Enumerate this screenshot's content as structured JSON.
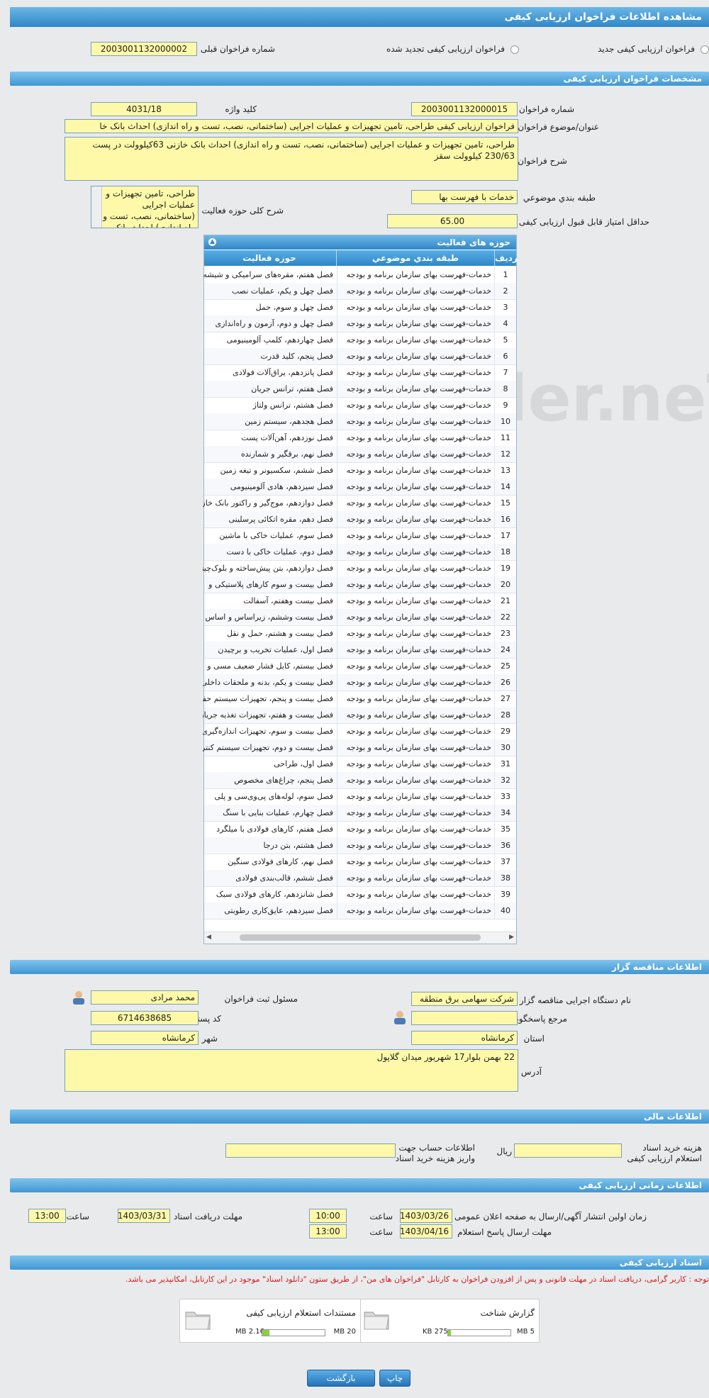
{
  "title": "مشاهده اطلاعات فراخوان ارزیابی کیفی",
  "type_options": {
    "new_label": "فراخوان ارزیابی کیفی جدید",
    "renewed_label": "فراخوان ارزیابی کیفی تجدید شده",
    "prev_label": "شماره فراخوان قبلی",
    "prev_value": "2003001132000002"
  },
  "spec": {
    "header": "مشخصات فراخوان ارزیابی کیفی",
    "number_label": "شماره فراخوان",
    "number_value": "2003001132000015",
    "keyword_label": "کلید واژه",
    "keyword_value": "4031/18",
    "subject_label": "عنوان/موضوع فراخوان",
    "subject_value": "فراخوان ارزیابی کیفی طراحی، تامین تجهیزات و عملیات اجرایی (ساختمانی، نصب، تست و راه اندازی) احداث بانک خا",
    "desc_label": "شرح فراخوان",
    "desc_value": "طراحی، تامین تجهیزات و عملیات اجرایی (ساختمانی، نصب، تست و راه اندازی) احداث بانک خازنی 63کیلوولت در پست 230/63 کیلوولت سقز",
    "category_label": "طبقه بندي موضوعي",
    "category_value": "خدمات با فهرست بها",
    "scope_label": "شرح کلی حوزه فعالیت",
    "scope_value": "طراحی، تامین تجهیزات و عملیات اجرایی (ساختمانی، نصب، تست و راه اندازی) احداث بانک",
    "min_score_label": "حداقل امتیاز قابل قبول ارزیابی کیفی",
    "min_score_value": "65.00"
  },
  "activities": {
    "title": "حوزه های فعالیت",
    "col_row": "رديف",
    "col_cat": "طبقه بندي موضوعي",
    "col_act": "حوزه فعالیت",
    "rows": [
      {
        "n": "1",
        "cat": "خدمات-فهرست بهای سازمان برنامه و بودجه",
        "act": "فصل هفتم، مقره‌های سرامیکی و شیشه"
      },
      {
        "n": "2",
        "cat": "خدمات-فهرست بهای سازمان برنامه و بودجه",
        "act": "فصل چهل و یکم، عملیات نصب"
      },
      {
        "n": "3",
        "cat": "خدمات-فهرست بهای سازمان برنامه و بودجه",
        "act": "فصل چهل و سوم، حمل"
      },
      {
        "n": "4",
        "cat": "خدمات-فهرست بهای سازمان برنامه و بودجه",
        "act": "فصل چهل و دوم، آزمون و راه‌اندازی"
      },
      {
        "n": "5",
        "cat": "خدمات-فهرست بهای سازمان برنامه و بودجه",
        "act": "فصل چهاردهم، کلمپ آلومینیومی"
      },
      {
        "n": "6",
        "cat": "خدمات-فهرست بهای سازمان برنامه و بودجه",
        "act": "فصل پنجم، کلید قدرت"
      },
      {
        "n": "7",
        "cat": "خدمات-فهرست بهای سازمان برنامه و بودجه",
        "act": "فصل پانزدهم، یراق‌آلات فولادی"
      },
      {
        "n": "8",
        "cat": "خدمات-فهرست بهای سازمان برنامه و بودجه",
        "act": "فصل هفتم، ترانس جریان"
      },
      {
        "n": "9",
        "cat": "خدمات-فهرست بهای سازمان برنامه و بودجه",
        "act": "فصل هشتم، ترانس ولتاژ"
      },
      {
        "n": "10",
        "cat": "خدمات-فهرست بهای سازمان برنامه و بودجه",
        "act": "فصل هجدهم، سیستم زمین"
      },
      {
        "n": "11",
        "cat": "خدمات-فهرست بهای سازمان برنامه و بودجه",
        "act": "فصل نوزدهم، آهن‌آلات پست"
      },
      {
        "n": "12",
        "cat": "خدمات-فهرست بهای سازمان برنامه و بودجه",
        "act": "فصل نهم، برقگیر و شمارنده"
      },
      {
        "n": "13",
        "cat": "خدمات-فهرست بهای سازمان برنامه و بودجه",
        "act": "فصل ششم، سکسیونر و تیغه زمین"
      },
      {
        "n": "14",
        "cat": "خدمات-فهرست بهای سازمان برنامه و بودجه",
        "act": "فصل سیزدهم، هادی آلومینیومی"
      },
      {
        "n": "15",
        "cat": "خدمات-فهرست بهای سازمان برنامه و بودجه",
        "act": "فصل دوازدهم، موج‌گیر و راکتور بانک خازنی"
      },
      {
        "n": "16",
        "cat": "خدمات-فهرست بهای سازمان برنامه و بودجه",
        "act": "فصل دهم، مقره اتکائی پرسلینی"
      },
      {
        "n": "17",
        "cat": "خدمات-فهرست بهای سازمان برنامه و بودجه",
        "act": "فصل سوم، عملیات خاکی با ماشین"
      },
      {
        "n": "18",
        "cat": "خدمات-فهرست بهای سازمان برنامه و بودجه",
        "act": "فصل دوم، عملیات خاکی با دست"
      },
      {
        "n": "19",
        "cat": "خدمات-فهرست بهای سازمان برنامه و بودجه",
        "act": "فصل دوازدهم، بتن پیش‌ساخته و بلوک‌چینی"
      },
      {
        "n": "20",
        "cat": "خدمات-فهرست بهای سازمان برنامه و بودجه",
        "act": "فصل بیست و سوم کارهای پلاستیکی و"
      },
      {
        "n": "21",
        "cat": "خدمات-فهرست بهای سازمان برنامه و بودجه",
        "act": "فصل بیست وهفتم، آسفالت"
      },
      {
        "n": "22",
        "cat": "خدمات-فهرست بهای سازمان برنامه و بودجه",
        "act": "فصل بیست وششم، زیراساس و اساس"
      },
      {
        "n": "23",
        "cat": "خدمات-فهرست بهای سازمان برنامه و بودجه",
        "act": "فصل بیست و هشتم، حمل و نقل"
      },
      {
        "n": "24",
        "cat": "خدمات-فهرست بهای سازمان برنامه و بودجه",
        "act": "فصل اول، عملیات تخریب و برچیدن"
      },
      {
        "n": "25",
        "cat": "خدمات-فهرست بهای سازمان برنامه و بودجه",
        "act": "فصل بیستم، کابل فشار ضعیف مسی و"
      },
      {
        "n": "26",
        "cat": "خدمات-فهرست بهای سازمان برنامه و بودجه",
        "act": "فصل بیست و یکم، بدنه و ملحقات داخلی"
      },
      {
        "n": "27",
        "cat": "خدمات-فهرست بهای سازمان برنامه و بودجه",
        "act": "فصل بیست و پنجم، تجهیزات سیستم حفاظت الکتریکی"
      },
      {
        "n": "28",
        "cat": "خدمات-فهرست بهای سازمان برنامه و بودجه",
        "act": "فصل بیست و هفتم، تجهیزات تغذیه جریان متناوب و مستقیم"
      },
      {
        "n": "29",
        "cat": "خدمات-فهرست بهای سازمان برنامه و بودجه",
        "act": "فصل بیست و سوم، تجهیزات اندازه‌گیری و ثبات"
      },
      {
        "n": "30",
        "cat": "خدمات-فهرست بهای سازمان برنامه و بودجه",
        "act": "فصل بیست و دوم، تجهیزات سیستم کنترل سنتی"
      },
      {
        "n": "31",
        "cat": "خدمات-فهرست بهای سازمان برنامه و بودجه",
        "act": "فصل اول، طراحی"
      },
      {
        "n": "32",
        "cat": "خدمات-فهرست بهای سازمان برنامه و بودجه",
        "act": "فصل پنجم، چراغ‌های مخصوص"
      },
      {
        "n": "33",
        "cat": "خدمات-فهرست بهای سازمان برنامه و بودجه",
        "act": "فصل سوم، لوله‌های پی‌وی‌سی و پلی"
      },
      {
        "n": "34",
        "cat": "خدمات-فهرست بهای سازمان برنامه و بودجه",
        "act": "فصل چهارم، عملیات بنایی با سنگ"
      },
      {
        "n": "35",
        "cat": "خدمات-فهرست بهای سازمان برنامه و بودجه",
        "act": "فصل هفتم، کارهای فولادی با میلگرد"
      },
      {
        "n": "36",
        "cat": "خدمات-فهرست بهای سازمان برنامه و بودجه",
        "act": "فصل هشتم، بتن درجا"
      },
      {
        "n": "37",
        "cat": "خدمات-فهرست بهای سازمان برنامه و بودجه",
        "act": "فصل نهم، کارهای فولادی سنگین"
      },
      {
        "n": "38",
        "cat": "خدمات-فهرست بهای سازمان برنامه و بودجه",
        "act": "فصل ششم، قالب‌بندی فولادی"
      },
      {
        "n": "39",
        "cat": "خدمات-فهرست بهای سازمان برنامه و بودجه",
        "act": "فصل شانزدهم، کارهای فولادی سبک"
      },
      {
        "n": "40",
        "cat": "خدمات-فهرست بهای سازمان برنامه و بودجه",
        "act": "فصل سیزدهم، عایق‌کاری رطوبتی"
      }
    ]
  },
  "tenderer": {
    "header": "اطلاعات مناقصه گزار",
    "org_label": "نام دستگاه اجرایی مناقصه گزار",
    "org_value": "شرکت سهامی برق منطقه",
    "registrar_label": "مسئول ثبت فراخوان",
    "registrar_value": "محمد مرادی",
    "ref_label": "مرجع پاسخگویی",
    "ref_value": "",
    "postal_label": "کد پستی",
    "postal_value": "6714638685",
    "province_label": "استان",
    "province_value": "کرمانشاه",
    "city_label": "شهر",
    "city_value": "کرمانشاه",
    "address_label": "آدرس",
    "address_value": "22 بهمن بلوار17 شهریور میدان گلاپول"
  },
  "finance": {
    "header": "اطلاعات مالی",
    "fee_label": "هزینه خرید اسناد استعلام ارزیابی کیفی",
    "currency": "ریال",
    "fee_value": "",
    "account_label": "اطلاعات حساب جهت واریز هزینه خرید اسناد",
    "account_value": ""
  },
  "timing": {
    "header": "اطلاعات زمانی ارزیابی کیفی",
    "publish_label": "زمان اولین انتشار آگهی/ارسال به صفحه اعلان عمومی",
    "publish_date": "1403/03/26",
    "publish_time": "10:00",
    "receive_label": "مهلت دریافت اسناد",
    "receive_date": "1403/03/31",
    "receive_time": "13:00",
    "reply_label": "مهلت ارسال پاسخ استعلام",
    "reply_date": "1403/04/16",
    "reply_time": "13:00",
    "time_label": "ساعت"
  },
  "documents": {
    "header": "اسناد ارزیابی کیفی",
    "note": "توجه : کاربر گرامی، دریافت اسناد در مهلت قانونی و پس از افزودن فراخوان به کارتابل \"فراخوان های من\"، از طریق ستون \"دانلود اسناد\" موجود در این کارتابل، امکانپذیر می باشد.",
    "files": [
      {
        "name": "گزارش شناخت",
        "size": "275 KB",
        "max": "5 MB",
        "fill": 0.05
      },
      {
        "name": "مستندات استعلام ارزیابی کیفی",
        "size": "2.16 MB",
        "max": "20 MB",
        "fill": 0.11
      }
    ]
  },
  "actions": {
    "print": "چاپ",
    "back": "بازگشت"
  },
  "watermark": "AriaTender.neT"
}
